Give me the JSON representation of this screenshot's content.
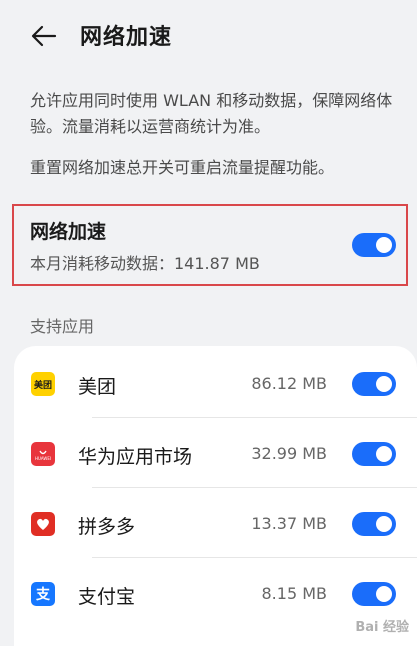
{
  "header": {
    "title": "网络加速",
    "back_icon": "arrow-left-icon"
  },
  "description": {
    "paragraph1": "允许应用同时使用 WLAN 和移动数据，保障网络体验。流量消耗以运营商统计为准。",
    "paragraph2": "重置网络加速总开关可重启流量提醒功能。"
  },
  "master_toggle": {
    "label": "网络加速",
    "usage": "本月消耗移动数据：141.87 MB",
    "enabled": true
  },
  "section": {
    "label": "支持应用"
  },
  "apps": [
    {
      "name": "美团",
      "size": "86.12 MB",
      "enabled": true,
      "icon": "meituan-icon",
      "icon_color": "#ffd100",
      "icon_text": "美团"
    },
    {
      "name": "华为应用市场",
      "size": "32.99 MB",
      "enabled": true,
      "icon": "huawei-appgallery-icon",
      "icon_color": "#e8353c",
      "icon_text": "HUAWEI"
    },
    {
      "name": "拼多多",
      "size": "13.37 MB",
      "enabled": true,
      "icon": "pinduoduo-icon",
      "icon_color": "#e02e24"
    },
    {
      "name": "支付宝",
      "size": "8.15 MB",
      "enabled": true,
      "icon": "alipay-icon",
      "icon_color": "#1677ff",
      "icon_text": "支"
    }
  ],
  "colors": {
    "accent": "#1a6dfa",
    "highlight_border": "#d9474a",
    "background": "#f1f2f4"
  },
  "watermark": {
    "text": "Bai 经验"
  }
}
